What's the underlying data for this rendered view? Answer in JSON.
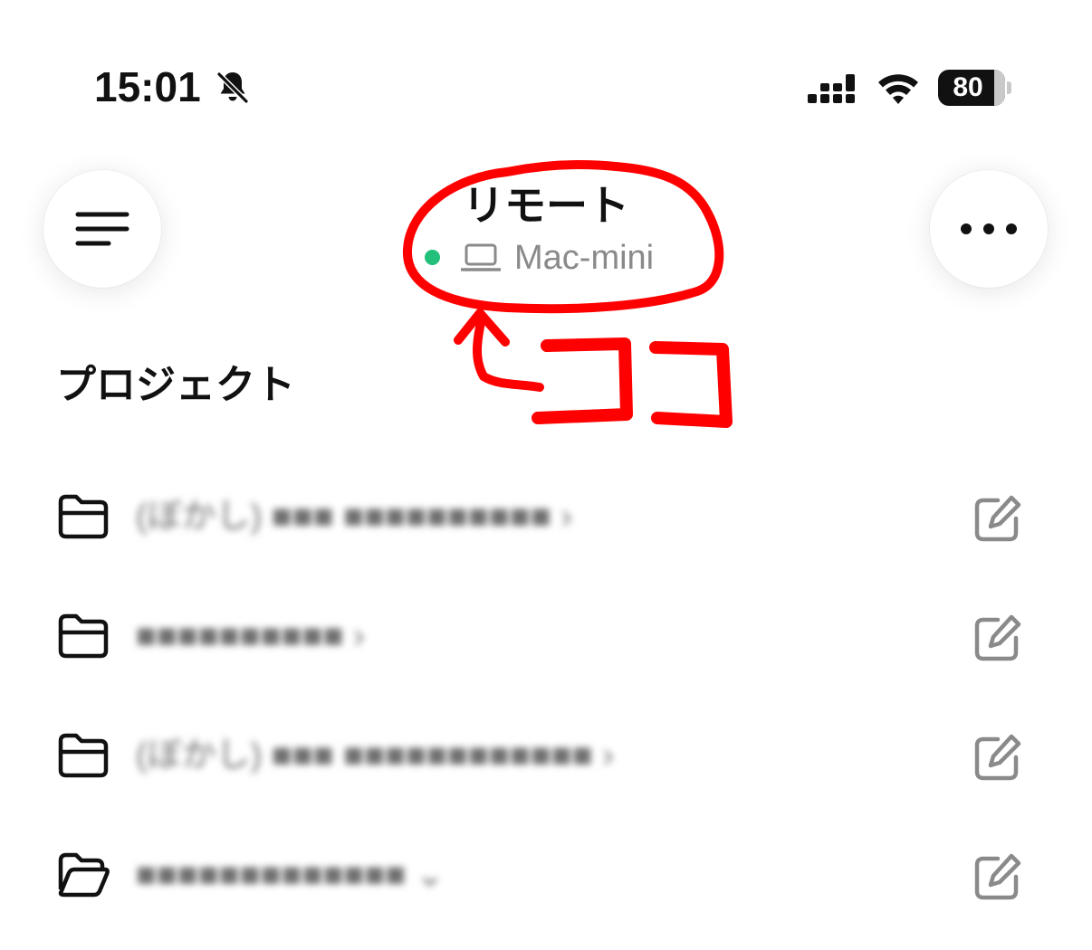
{
  "status_bar": {
    "time": "15:01",
    "battery": "80",
    "icons": [
      "bell-slash-icon",
      "signal-icon",
      "wifi-icon",
      "battery-icon"
    ]
  },
  "header": {
    "title": "リモート",
    "device_name": "Mac-mini",
    "status_color": "#22c07a",
    "icons": [
      "menu-icon",
      "more-icon",
      "laptop-icon"
    ]
  },
  "annotation": {
    "text": "ココ",
    "color": "#ff0000"
  },
  "section": {
    "title": "プロジェクト"
  },
  "projects": [
    {
      "name": "(ぼかし) ■■■ ■■■■■■■■■■ ›",
      "icon": "folder-icon",
      "action_icon": "edit-icon"
    },
    {
      "name": "■■■■■■■■■■ ›",
      "icon": "folder-icon",
      "action_icon": "edit-icon"
    },
    {
      "name": "(ぼかし) ■■■ ■■■■■■■■■■■■ ›",
      "icon": "folder-icon",
      "action_icon": "edit-icon"
    },
    {
      "name": "■■■■■■■■■■■■■ ⌄",
      "icon": "folder-open-icon",
      "action_icon": "edit-icon"
    }
  ]
}
